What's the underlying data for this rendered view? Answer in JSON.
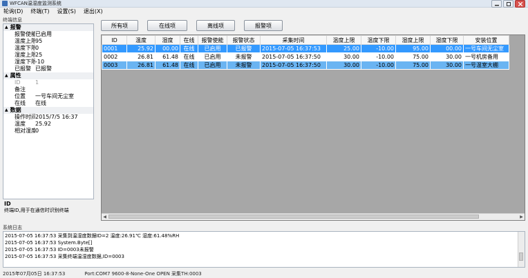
{
  "window": {
    "title": "WFCAN温湿度监测系统"
  },
  "menu": [
    "轮询(D)",
    "终端(T)",
    "设置(S)",
    "退出(X)"
  ],
  "left_panel": {
    "title": "终端信息",
    "categories": [
      {
        "name": "报警",
        "rows": [
          {
            "key": "报警使能",
            "value": "已启用"
          },
          {
            "key": "温度上限",
            "value": "95"
          },
          {
            "key": "温度下限",
            "value": "0"
          },
          {
            "key": "湿度上限",
            "value": "25"
          },
          {
            "key": "湿度下限",
            "value": "-10"
          },
          {
            "key": "已报警",
            "value": "已报警"
          }
        ]
      },
      {
        "name": "属性",
        "rows": [
          {
            "key": "ID",
            "value": "1",
            "disabled": true
          },
          {
            "key": "备注",
            "value": ""
          },
          {
            "key": "位置",
            "value": "一号车间无尘室"
          },
          {
            "key": "在线",
            "value": "在线"
          }
        ]
      },
      {
        "name": "数据",
        "rows": [
          {
            "key": "操作时间",
            "value": "2015/7/5 16:37"
          },
          {
            "key": "温度",
            "value": "25.92"
          },
          {
            "key": "相对湿度",
            "value": "0"
          }
        ]
      }
    ],
    "description": {
      "title": "ID",
      "text": "终端ID,用于在通信时识别终端"
    }
  },
  "filter_buttons": [
    "所有项",
    "在线项",
    "离线项",
    "报警项"
  ],
  "table": {
    "columns": [
      "ID",
      "温度",
      "湿度",
      "在线",
      "报警使能",
      "报警状态",
      "采集时间",
      "温度上限",
      "温度下限",
      "湿度上限",
      "湿度下限",
      "安装位置"
    ],
    "rows": [
      [
        "0001",
        "25.92",
        "00.00",
        "在线",
        "已启用",
        "已报警",
        "2015-07-05 16:37:53",
        "25.00",
        "-10.00",
        "95.00",
        "00.00",
        "一号车间无尘室"
      ],
      [
        "0002",
        "26.81",
        "61.48",
        "在线",
        "已启用",
        "未报警",
        "2015-07-05 16:37:50",
        "30.00",
        "-10.00",
        "75.00",
        "30.00",
        "一号机房备用"
      ],
      [
        "0003",
        "26.81",
        "61.48",
        "在线",
        "已启用",
        "未报警",
        "2015-07-05 16:37:50",
        "30.00",
        "-10.00",
        "75.00",
        "30.00",
        "一号温室大棚"
      ]
    ]
  },
  "log": {
    "title": "系统日志",
    "lines": [
      "2015-07-05 16:37:53 采集到温湿度数据ID=2  温度:26.91℃ 湿度:61.48%RH",
      "2015-07-05 16:37:53 System.Byte[]",
      "2015-07-05 16:37:53 ID=0003未报警",
      "2015-07-05 16:37:53 采集终端温湿度数据,ID=0003"
    ]
  },
  "status": {
    "time": "2015年07月05日 16:37:53",
    "port": "Port:COM7 9600-8-None-One OPEN  采集TH:0003"
  },
  "colors": {
    "selected_row": "#3399ff",
    "alt_row": "#6ab4f2"
  }
}
